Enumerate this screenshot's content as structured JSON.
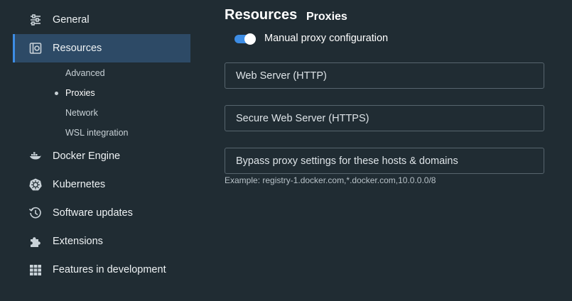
{
  "sidebar": {
    "items": [
      {
        "label": "General",
        "icon": "sliders-icon"
      },
      {
        "label": "Resources",
        "icon": "resources-icon"
      },
      {
        "label": "Docker Engine",
        "icon": "whale-icon"
      },
      {
        "label": "Kubernetes",
        "icon": "helm-icon"
      },
      {
        "label": "Software updates",
        "icon": "history-icon"
      },
      {
        "label": "Extensions",
        "icon": "puzzle-icon"
      },
      {
        "label": "Features in development",
        "icon": "grid-icon"
      }
    ],
    "active": "Resources",
    "subitems": [
      {
        "label": "Advanced"
      },
      {
        "label": "Proxies"
      },
      {
        "label": "Network"
      },
      {
        "label": "WSL integration"
      }
    ],
    "active_subitem": "Proxies"
  },
  "main": {
    "title": "Resources",
    "subtitle": "Proxies",
    "toggle": {
      "label": "Manual proxy configuration",
      "on": true
    },
    "fields": {
      "http": {
        "placeholder": "Web Server (HTTP)",
        "value": ""
      },
      "https": {
        "placeholder": "Secure Web Server (HTTPS)",
        "value": ""
      },
      "bypass": {
        "placeholder": "Bypass proxy settings for these hosts & domains",
        "value": ""
      }
    },
    "bypass_help": "Example: registry-1.docker.com,*.docker.com,10.0.0.0/8"
  },
  "colors": {
    "background": "#202c33",
    "active_nav_bg": "#2d4a66",
    "accent": "#3d8de5",
    "field_border": "#57656e"
  }
}
